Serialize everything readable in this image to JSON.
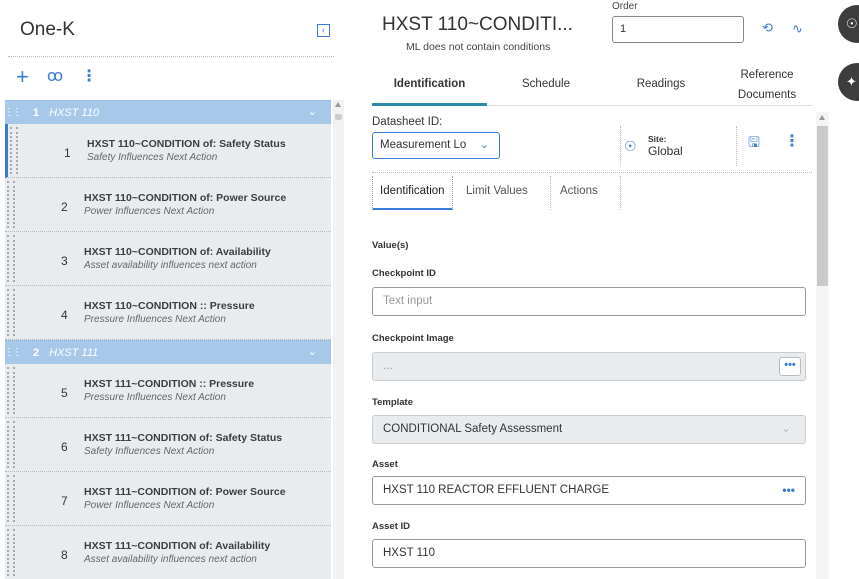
{
  "left": {
    "title": "One-K",
    "toolbar": {
      "add": "+",
      "search": "ꝏ",
      "more": "⋮"
    },
    "groups": [
      {
        "num": "1",
        "name": "HXST 110",
        "items": [
          {
            "num": "1",
            "title": "HXST 110~CONDITION of: Safety Status",
            "subtitle": "Safety Influences Next Action"
          },
          {
            "num": "2",
            "title": "HXST 110~CONDITION of: Power Source",
            "subtitle": "Power Influences Next Action"
          },
          {
            "num": "3",
            "title": "HXST 110~CONDITION of: Availability",
            "subtitle": "Asset availability influences next action"
          },
          {
            "num": "4",
            "title": "HXST 110~CONDITION :: Pressure",
            "subtitle": "Pressure Influences Next Action"
          }
        ]
      },
      {
        "num": "2",
        "name": "HXST 111",
        "items": [
          {
            "num": "5",
            "title": "HXST 111~CONDITION :: Pressure",
            "subtitle": "Pressure Influences Next Action"
          },
          {
            "num": "6",
            "title": "HXST 111~CONDITION of: Safety Status",
            "subtitle": "Safety Influences Next Action"
          },
          {
            "num": "7",
            "title": "HXST 111~CONDITION of: Power Source",
            "subtitle": "Power Influences Next Action"
          },
          {
            "num": "8",
            "title": "HXST 111~CONDITION of: Availability",
            "subtitle": "Asset availability influences next action"
          }
        ]
      }
    ]
  },
  "header": {
    "title": "HXST 110~CONDITI...",
    "subtitle": "ML does not contain conditions",
    "order_label": "Order",
    "order_value": "1"
  },
  "tabs": {
    "identification": "Identification",
    "schedule": "Schedule",
    "readings": "Readings",
    "reference_line1": "Reference",
    "reference_line2": "Documents"
  },
  "datasheet": {
    "label": "Datasheet ID:",
    "value": "Measurement Lo",
    "site_label": "Site:",
    "site_value": "Global"
  },
  "sub_tabs": {
    "identification": "Identification",
    "limit_values": "Limit Values",
    "actions": "Actions"
  },
  "form": {
    "values_label": "Value(s)",
    "checkpoint_id_label": "Checkpoint ID",
    "checkpoint_id_placeholder": "Text input",
    "checkpoint_image_label": "Checkpoint Image",
    "checkpoint_image_value": "...",
    "template_label": "Template",
    "template_value": "CONDITIONAL Safety Assessment",
    "asset_label": "Asset",
    "asset_value": "HXST 110 REACTOR EFFLUENT CHARGE",
    "asset_id_label": "Asset ID",
    "asset_id_value": "HXST 110"
  },
  "colors": {
    "accent": "#3a7bd5",
    "group_header": "#a8c8ea",
    "item_bg": "#e9ecef",
    "tab_underline": "#2b8aa8"
  }
}
